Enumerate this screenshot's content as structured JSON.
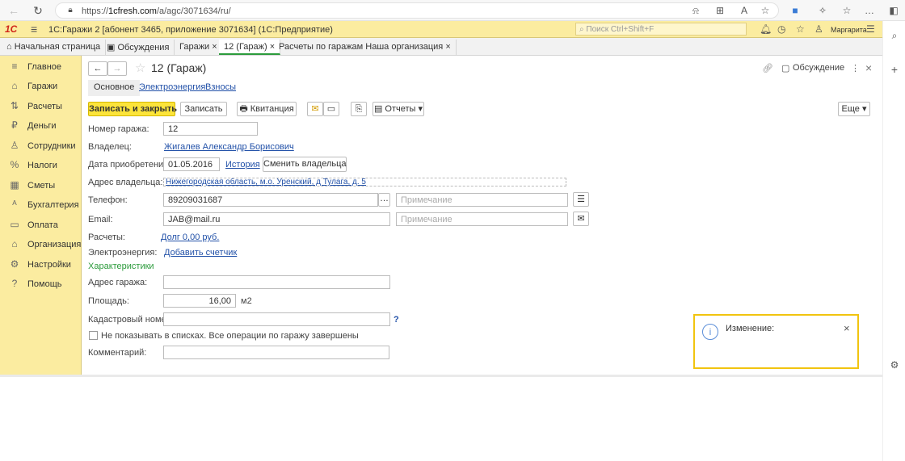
{
  "browser": {
    "url_prefix": "https://",
    "url_host": "1cfresh.com",
    "url_path": "/a/agc/3071634/ru/"
  },
  "app": {
    "logo": "1С",
    "title": "1С:Гаражи 2 [абонент 3465, приложение 3071634]  (1С:Предприятие)",
    "search_placeholder": "Поиск Ctrl+Shift+F",
    "user": "Маргарита"
  },
  "tabs": [
    {
      "label": "Начальная страница"
    },
    {
      "label": "Обсуждения"
    },
    {
      "label": "Гаражи ×"
    },
    {
      "label": "12 (Гараж) ×"
    },
    {
      "label": "Расчеты по гаражам Наша организация ×"
    }
  ],
  "sidebar": {
    "items": [
      {
        "label": "Главное",
        "icon": "≡"
      },
      {
        "label": "Гаражи",
        "icon": "⌂"
      },
      {
        "label": "Расчеты",
        "icon": "⇅"
      },
      {
        "label": "Деньги",
        "icon": "₽"
      },
      {
        "label": "Сотрудники",
        "icon": "♙"
      },
      {
        "label": "Налоги",
        "icon": "%"
      },
      {
        "label": "Сметы",
        "icon": "▦"
      },
      {
        "label": "Бухгалтерия",
        "icon": "ᴬ"
      },
      {
        "label": "Оплата",
        "icon": "▭"
      },
      {
        "label": "Организация",
        "icon": "⌂"
      },
      {
        "label": "Настройки",
        "icon": "⚙"
      },
      {
        "label": "Помощь",
        "icon": "?"
      }
    ]
  },
  "form": {
    "title": "12 (Гараж)",
    "discussion": "Обсуждение",
    "subtabs": [
      "Основное",
      "Электроэнергия",
      "Взносы"
    ],
    "toolbar": {
      "save_close": "Записать и закрыть",
      "save": "Записать",
      "receipt": "Квитанция",
      "reports": "Отчеты ▾",
      "more": "Еще ▾"
    },
    "labels": {
      "garage_number": "Номер гаража:",
      "owner": "Владелец:",
      "purchase_date": "Дата приобретения:",
      "owner_address": "Адрес владельца:",
      "phone": "Телефон:",
      "email": "Email:",
      "settlements": "Расчеты:",
      "electricity": "Электроэнергия:",
      "characteristics": "Характеристики",
      "garage_address": "Адрес гаража:",
      "area": "Площадь:",
      "area_unit": "м2",
      "cadastral": "Кадастровый номер:",
      "hide_checkbox": "Не показывать в списках. Все операции по гаражу завершены",
      "comment": "Комментарий:"
    },
    "values": {
      "garage_number": "12",
      "owner": "Жигалев Александр Борисович",
      "purchase_date": "01.05.2016",
      "history_link": "История",
      "change_owner": "Сменить владельца",
      "owner_address": "Нижегородская область, м.о. Уренский, д Тулага, д. 5",
      "phone": "89209031687",
      "phone_note_placeholder": "Примечание",
      "email": "JAB@mail.ru",
      "email_note_placeholder": "Примечание",
      "settlements_link": "Долг 0,00 руб.",
      "electricity_link": "Добавить счетчик",
      "area": "16,00",
      "cadastral_help": "?"
    }
  },
  "notification": {
    "title": "Изменение:"
  }
}
